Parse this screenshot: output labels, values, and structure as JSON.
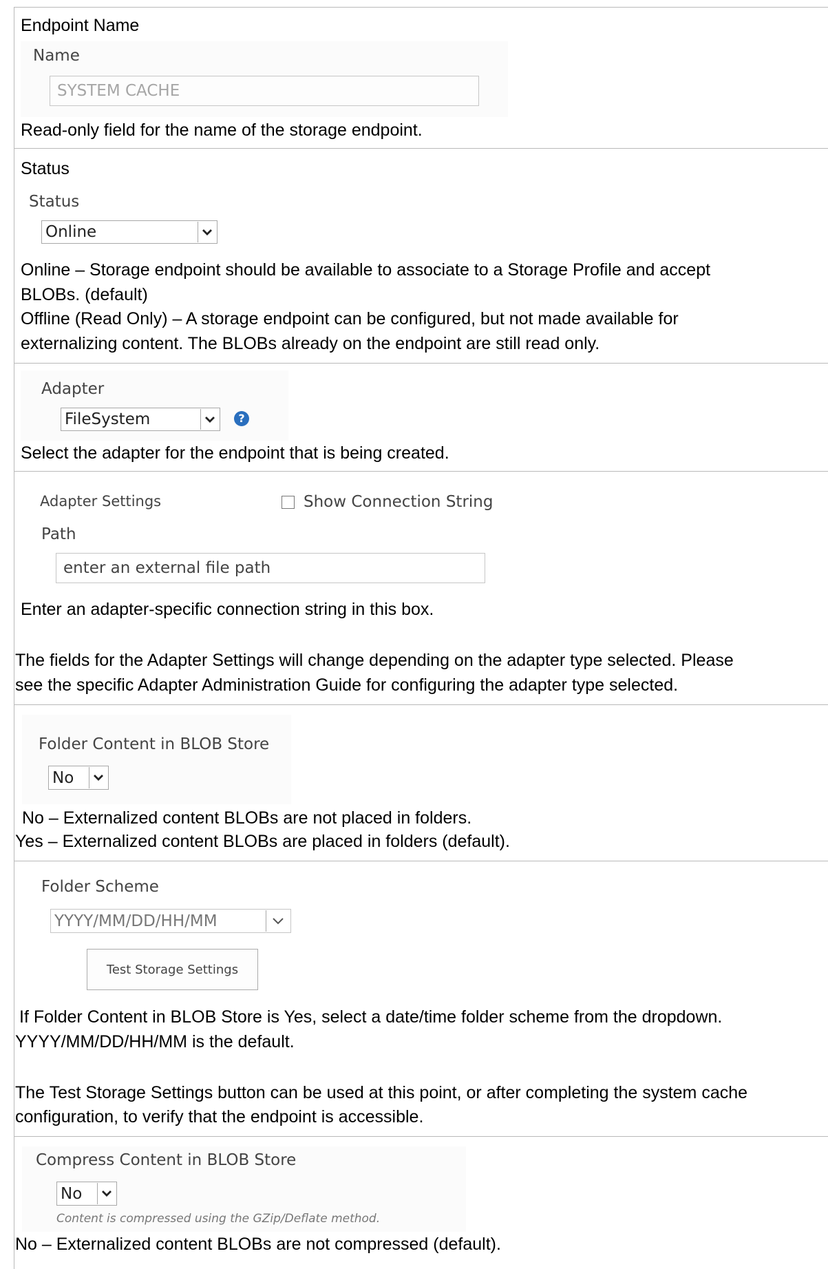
{
  "endpoint_name": {
    "heading": "Endpoint Name",
    "field_label": "Name",
    "field_value": "SYSTEM CACHE",
    "description": "Read-only field for the name of the storage endpoint."
  },
  "status": {
    "heading": "Status",
    "field_label": "Status",
    "selected": "Online",
    "description_lines": [
      "Online – Storage endpoint should be available to associate to a Storage Profile and accept",
      "BLOBs. (default)",
      "Offline (Read Only) – A storage endpoint can be configured, but not made available for",
      "externalizing content. The BLOBs already on the endpoint are still read only."
    ]
  },
  "adapter": {
    "field_label": "Adapter",
    "selected": "FileSystem",
    "help_icon": "question-circle-icon",
    "help_glyph": "?",
    "description": "Select the adapter for the endpoint that is being created."
  },
  "adapter_settings": {
    "label": "Adapter Settings",
    "checkbox_label": "Show Connection String",
    "path_label": "Path",
    "path_placeholder": "enter an external file path",
    "description": "Enter an adapter-specific connection string in this box.",
    "note_lines": [
      "The fields for the Adapter Settings will change depending on the adapter type selected. Please",
      "see the specific Adapter Administration Guide for configuring the adapter type selected."
    ]
  },
  "folder_content": {
    "field_label": "Folder Content in BLOB Store",
    "selected": "No",
    "description_lines": [
      "No – Externalized content BLOBs are not placed in folders.",
      "Yes – Externalized content BLOBs are placed in folders (default)."
    ]
  },
  "folder_scheme": {
    "field_label": "Folder Scheme",
    "selected": "YYYY/MM/DD/HH/MM",
    "button_label": "Test Storage Settings",
    "description_lines": [
      "If Folder Content in BLOB Store is Yes, select a date/time folder scheme from the dropdown.",
      "YYYY/MM/DD/HH/MM is the default."
    ],
    "note_lines": [
      "The Test Storage Settings button can be used at this point, or after completing the system cache",
      "configuration, to verify that the endpoint is accessible."
    ]
  },
  "compress_content": {
    "field_label": "Compress Content in BLOB Store",
    "selected": "No",
    "hint": "Content is compressed using the GZip/Deflate method.",
    "description": "No – Externalized content BLOBs are not compressed (default)."
  },
  "colors": {
    "border": "#b9b9b9",
    "help_icon": "#2a6fbe",
    "label_text": "#444444"
  }
}
